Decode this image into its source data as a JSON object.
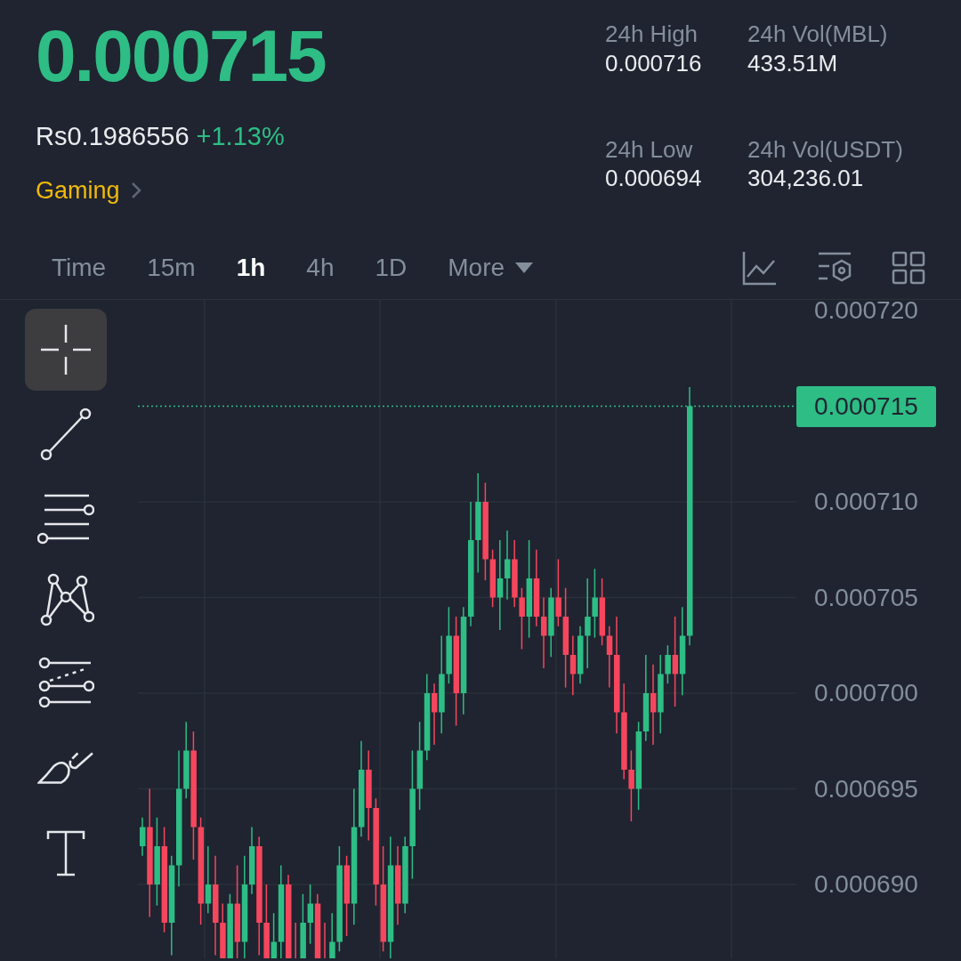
{
  "ticker": {
    "last_price": "0.000715",
    "fiat_price": "Rs0.1986556",
    "change": "+1.13%",
    "category": "Gaming"
  },
  "stats": [
    {
      "label": "24h High",
      "value": "0.000716"
    },
    {
      "label": "24h Vol(MBL)",
      "value": "433.51M"
    },
    {
      "label": "24h Low",
      "value": "0.000694"
    },
    {
      "label": "24h Vol(USDT)",
      "value": "304,236.01"
    }
  ],
  "intervals": [
    {
      "label": "Time",
      "selected": false,
      "kind": "tab"
    },
    {
      "label": "15m",
      "selected": false,
      "kind": "tab"
    },
    {
      "label": "1h",
      "selected": true,
      "kind": "tab"
    },
    {
      "label": "4h",
      "selected": false,
      "kind": "tab"
    },
    {
      "label": "1D",
      "selected": false,
      "kind": "tab"
    },
    {
      "label": "More",
      "selected": false,
      "kind": "dropdown"
    }
  ],
  "drawing_tools": [
    {
      "kind": "crosshair",
      "selected": true
    },
    {
      "kind": "trend-line",
      "selected": false
    },
    {
      "kind": "parallel-lines",
      "selected": false
    },
    {
      "kind": "pattern",
      "selected": false
    },
    {
      "kind": "fib",
      "selected": false
    },
    {
      "kind": "brush",
      "selected": false
    },
    {
      "kind": "text",
      "selected": false
    }
  ],
  "chart": {
    "y_axis_labels": [
      "0.000720",
      "0.000710",
      "0.000705",
      "0.000700",
      "0.000695",
      "0.000690"
    ],
    "current_price_tag": "0.000715"
  }
}
